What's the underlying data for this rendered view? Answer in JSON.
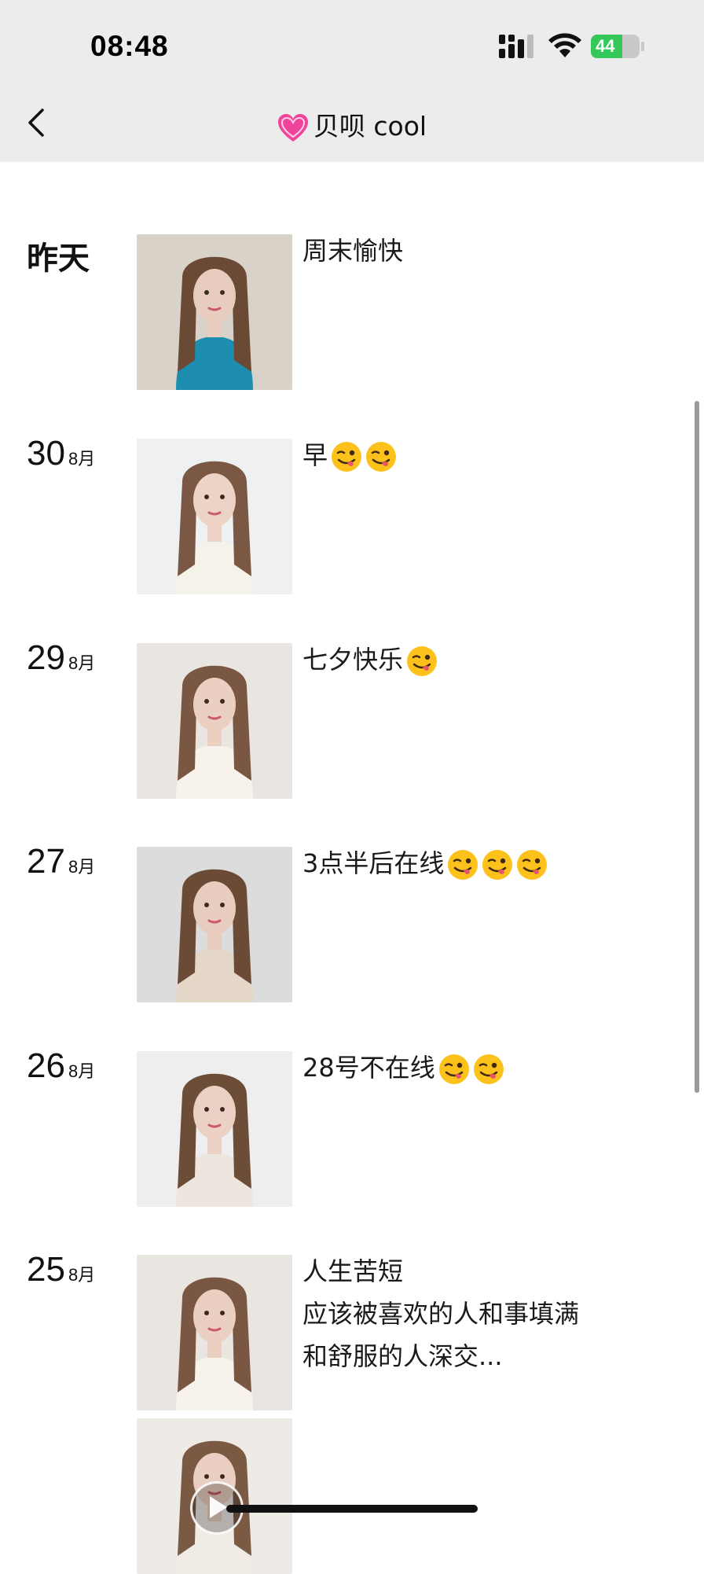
{
  "status": {
    "time": "08:48",
    "battery": "44"
  },
  "header": {
    "title": "贝呗 cool",
    "title_icon": "pink-heart-icon"
  },
  "posts": [
    {
      "day": "昨天",
      "month": "",
      "caption_lines": [
        "周末愉快"
      ],
      "emoji_count": 0,
      "photo_colors": [
        "#d8d2c8",
        "#1d8db0",
        "#e8cdbf",
        "#6b4a35"
      ]
    },
    {
      "day": "30",
      "month": "8月",
      "caption_lines": [
        "早"
      ],
      "emoji_count": 2,
      "photo_colors": [
        "#eef0f2",
        "#f5f2ea",
        "#ecd3c6",
        "#7a5843"
      ]
    },
    {
      "day": "29",
      "month": "8月",
      "caption_lines": [
        "七夕快乐"
      ],
      "emoji_count": 1,
      "photo_colors": [
        "#e9e6e2",
        "#f7f3ec",
        "#ebd0c2",
        "#7a5742"
      ]
    },
    {
      "day": "27",
      "month": "8月",
      "caption_lines": [
        "3点半后在线"
      ],
      "emoji_count": 3,
      "photo_colors": [
        "#dcdcdc",
        "#e5d7c8",
        "#e8ccbd",
        "#6b4b36"
      ]
    },
    {
      "day": "26",
      "month": "8月",
      "caption_lines": [
        "28号不在线"
      ],
      "emoji_count": 2,
      "photo_colors": [
        "#eeeeee",
        "#ece6de",
        "#ebd1c4",
        "#6c4d38"
      ]
    },
    {
      "day": "25",
      "month": "8月",
      "caption_lines": [
        "人生苦短",
        "应该被喜欢的人和事填满",
        "和舒服的人深交..."
      ],
      "emoji_count": 0,
      "photo_colors": [
        "#e9e6e2",
        "#f7f3ec",
        "#ebd0c2",
        "#7a5742"
      ]
    }
  ],
  "extra_video": {
    "photo_colors": [
      "#eeeae6",
      "#f0ebe5",
      "#ebcfc2",
      "#7b5a44"
    ],
    "icon": "play-icon"
  }
}
